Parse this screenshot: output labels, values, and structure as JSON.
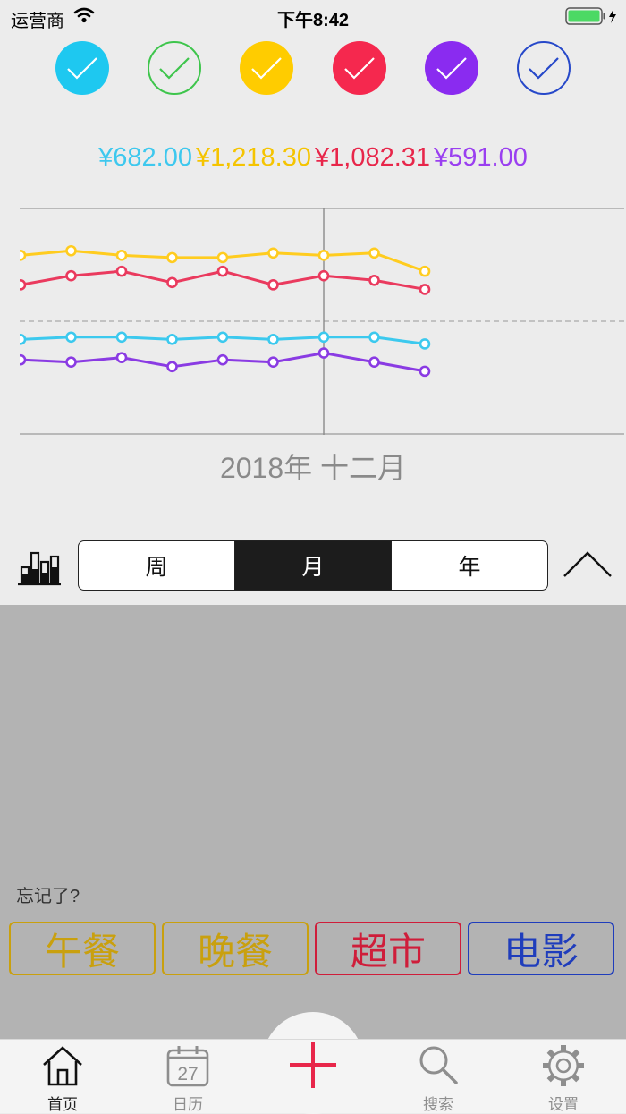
{
  "status": {
    "carrier": "运营商",
    "time": "下午8:42"
  },
  "filters": [
    {
      "name": "cyan",
      "color": "#1ec8f0",
      "filled": true
    },
    {
      "name": "green",
      "color": "#3ec54c",
      "filled": false
    },
    {
      "name": "yellow",
      "color": "#ffcc00",
      "filled": true
    },
    {
      "name": "red",
      "color": "#f5284e",
      "filled": true
    },
    {
      "name": "purple",
      "color": "#8a2bf0",
      "filled": true
    },
    {
      "name": "blue",
      "color": "#2648c9",
      "filled": false
    }
  ],
  "totals": [
    {
      "text": "¥682.00",
      "color": "#3ec8ee"
    },
    {
      "text": "¥1,218.30",
      "color": "#f5c400"
    },
    {
      "text": "¥1,082.31",
      "color": "#e8264a"
    },
    {
      "text": "¥591.00",
      "color": "#9a3ff0"
    }
  ],
  "chart_data": {
    "type": "line",
    "title": "2018年 十二月",
    "x": [
      0,
      1,
      2,
      3,
      4,
      5,
      6,
      7,
      8
    ],
    "series": [
      {
        "color": "#ffcc1f",
        "values": [
          0.79,
          0.81,
          0.79,
          0.78,
          0.78,
          0.8,
          0.79,
          0.8,
          0.72
        ]
      },
      {
        "color": "#ea3a5e",
        "values": [
          0.66,
          0.7,
          0.72,
          0.67,
          0.72,
          0.66,
          0.7,
          0.68,
          0.64
        ]
      },
      {
        "color": "#3cc9ee",
        "values": [
          0.42,
          0.43,
          0.43,
          0.42,
          0.43,
          0.42,
          0.43,
          0.43,
          0.4
        ]
      },
      {
        "color": "#8a3be3",
        "values": [
          0.33,
          0.32,
          0.34,
          0.3,
          0.33,
          0.32,
          0.36,
          0.32,
          0.28
        ]
      }
    ],
    "ylim": [
      0,
      1
    ],
    "grid": true,
    "reference_line": 0.5,
    "highlight_index": 6
  },
  "period": {
    "segments": [
      "周",
      "月",
      "年"
    ],
    "selected": "月"
  },
  "forgot_label": "忘记了?",
  "quick_buttons": [
    {
      "label": "午餐",
      "color": "#c9a00e"
    },
    {
      "label": "晚餐",
      "color": "#c9a00e"
    },
    {
      "label": "超市",
      "color": "#cf1d3a"
    },
    {
      "label": "电影",
      "color": "#1f3dbc"
    }
  ],
  "tabs": [
    {
      "label": "首页",
      "icon": "home-icon",
      "active": true
    },
    {
      "label": "日历",
      "icon": "calendar-icon",
      "day": "27"
    },
    {
      "label": "搜索",
      "icon": "search-icon"
    },
    {
      "label": "设置",
      "icon": "gear-icon"
    }
  ],
  "add_button": {
    "icon": "plus-icon",
    "color": "#e8264a"
  }
}
